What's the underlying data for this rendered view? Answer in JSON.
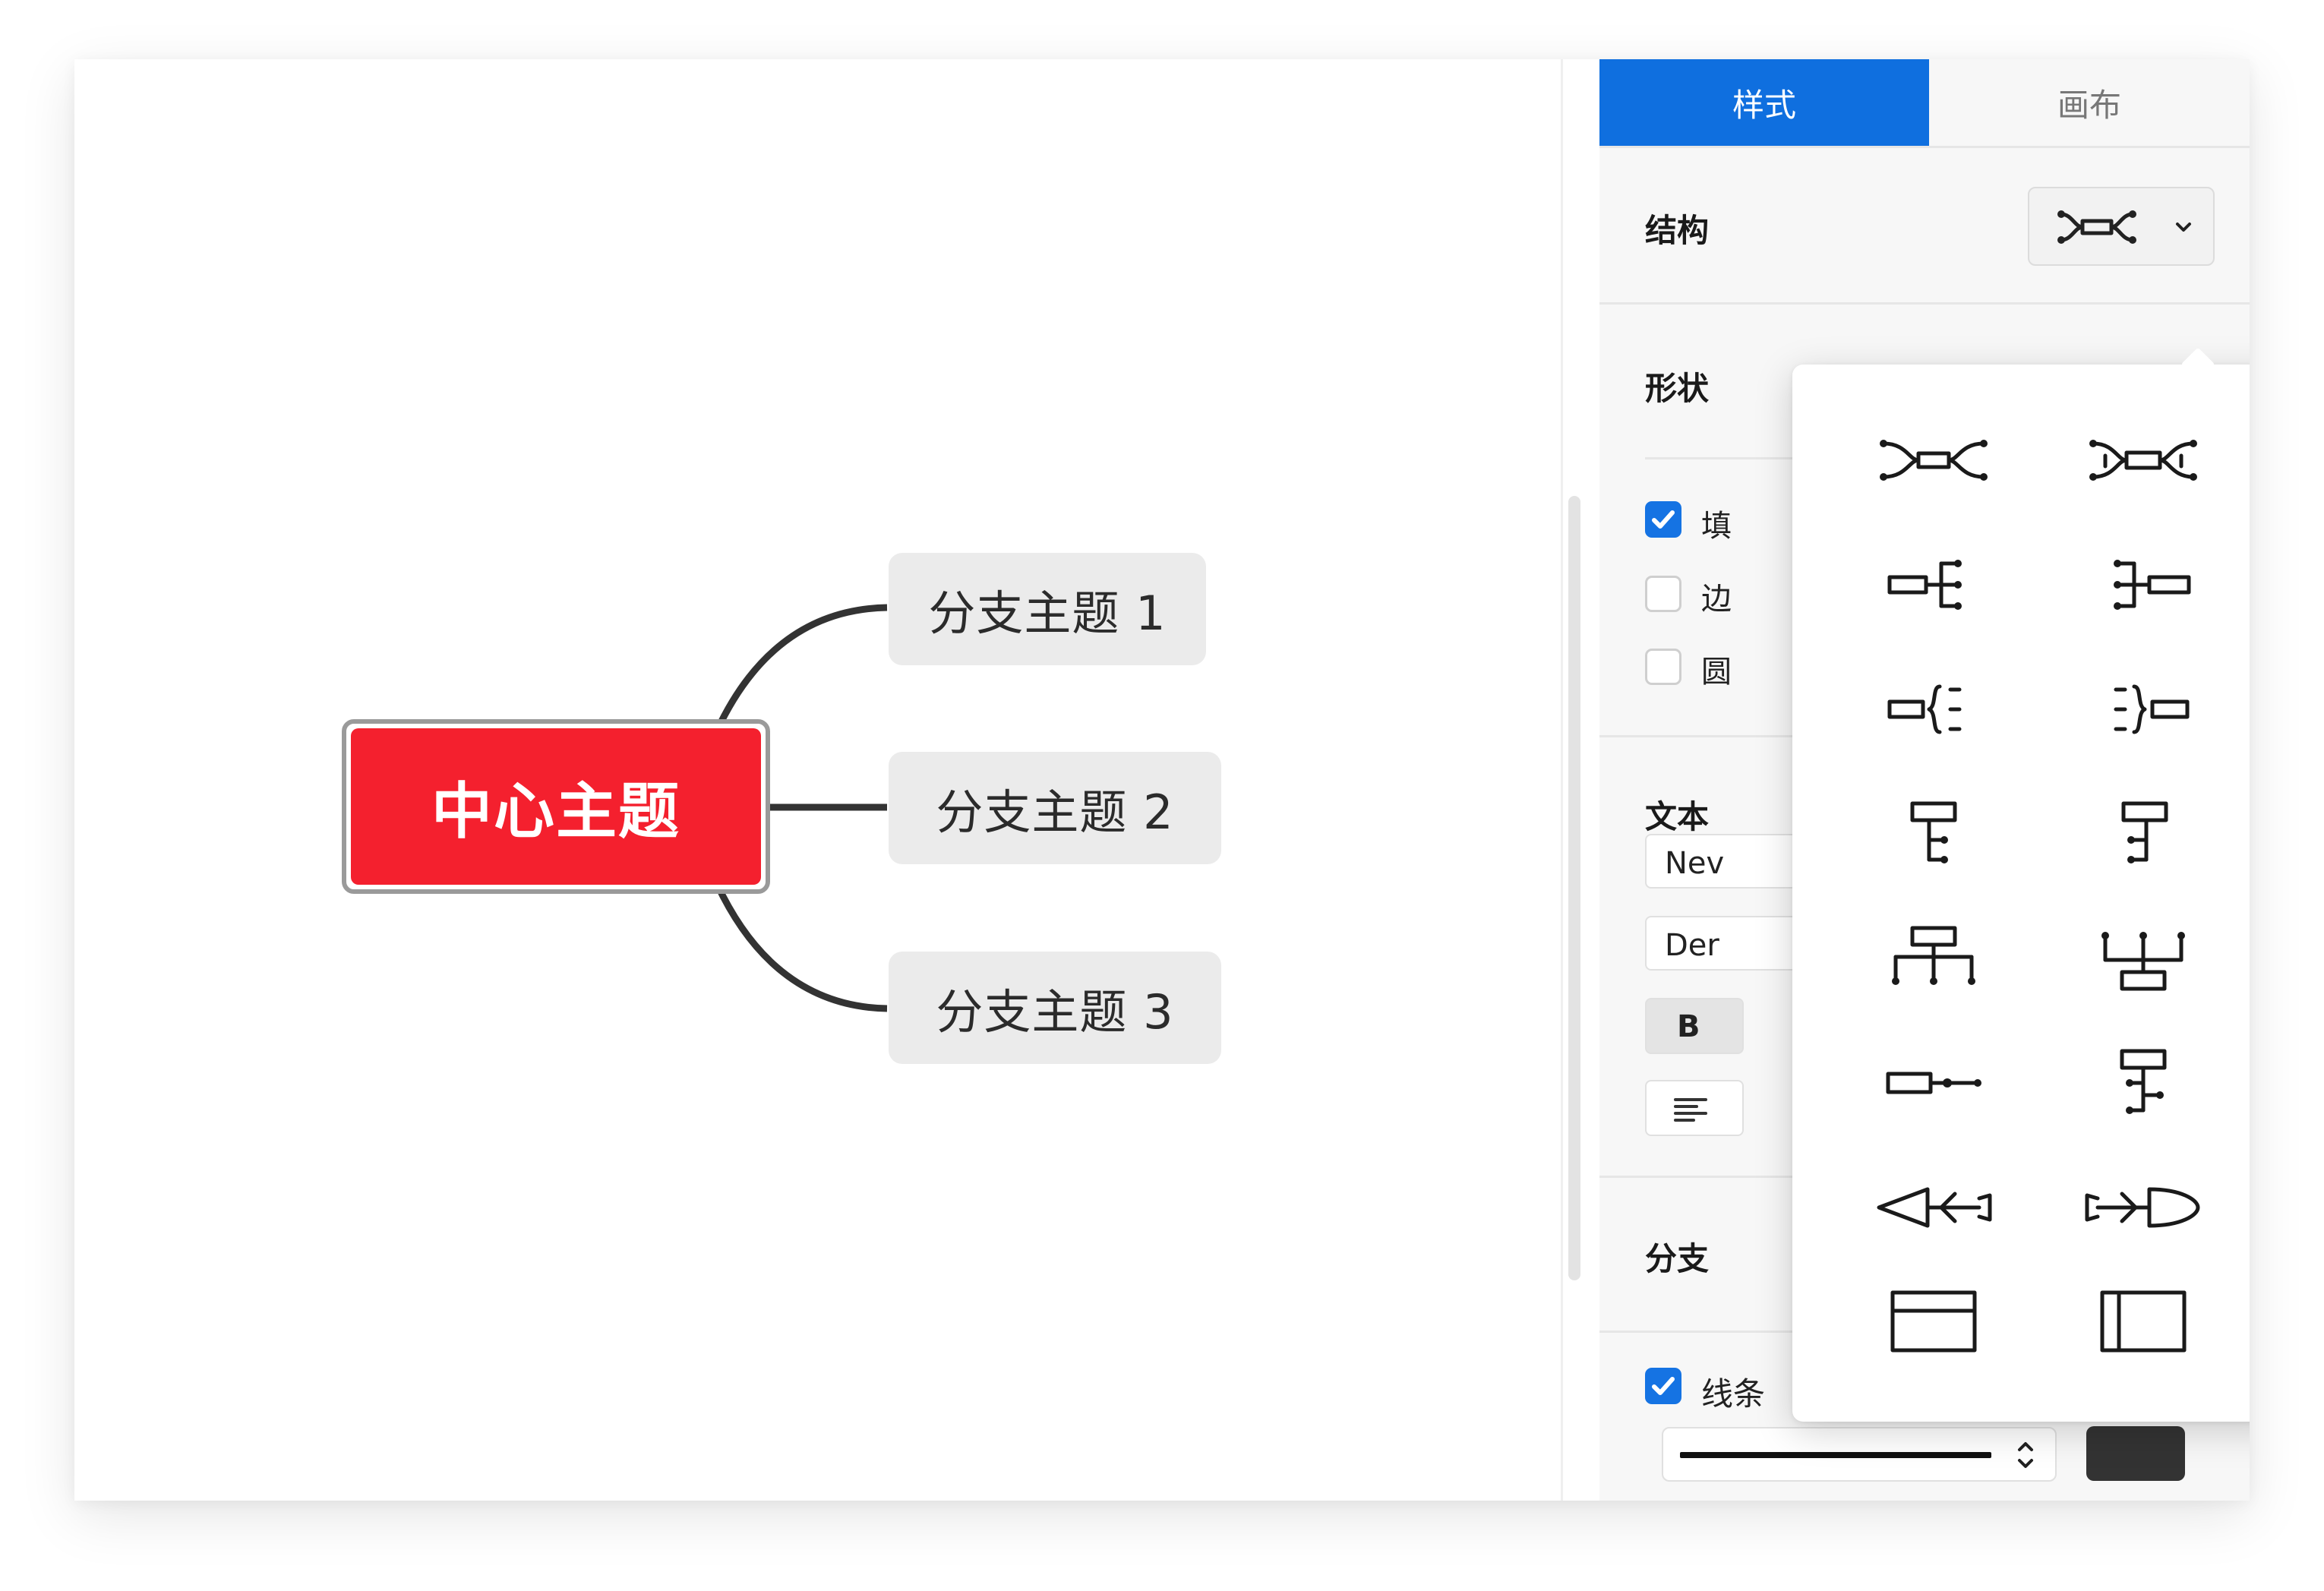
{
  "map": {
    "central_topic": "中心主题",
    "branches": [
      "分支主题 1",
      "分支主题 2",
      "分支主题 3"
    ]
  },
  "panel": {
    "tabs": [
      {
        "label": "样式",
        "active": true
      },
      {
        "label": "画布",
        "active": false
      }
    ],
    "structure_label": "结构",
    "shape_label": "形状",
    "text_label": "文本",
    "branch_label": "分支",
    "line_label": "线条",
    "checkboxes": [
      {
        "label_fragment": "填",
        "checked": true
      },
      {
        "label_fragment": "边",
        "checked": false
      },
      {
        "label_fragment": "圆",
        "checked": false
      }
    ],
    "font_family_partial": "Nev",
    "font_style_partial": "Der",
    "bold_label": "B",
    "line_checked": true,
    "line_color": "#333333",
    "accent_color": "#1573e3",
    "central_color": "#f4202e"
  },
  "structure_options": [
    {
      "name": "mindmap-both-sides"
    },
    {
      "name": "mindmap-both-sides-numbered"
    },
    {
      "name": "logic-right"
    },
    {
      "name": "logic-left"
    },
    {
      "name": "brace-right"
    },
    {
      "name": "brace-left"
    },
    {
      "name": "tree-right"
    },
    {
      "name": "tree-left"
    },
    {
      "name": "org-chart-down"
    },
    {
      "name": "org-chart-up"
    },
    {
      "name": "timeline-horizontal"
    },
    {
      "name": "tree-vertical"
    },
    {
      "name": "fishbone-left"
    },
    {
      "name": "fishbone-right"
    },
    {
      "name": "matrix-rows"
    },
    {
      "name": "matrix-columns"
    }
  ]
}
